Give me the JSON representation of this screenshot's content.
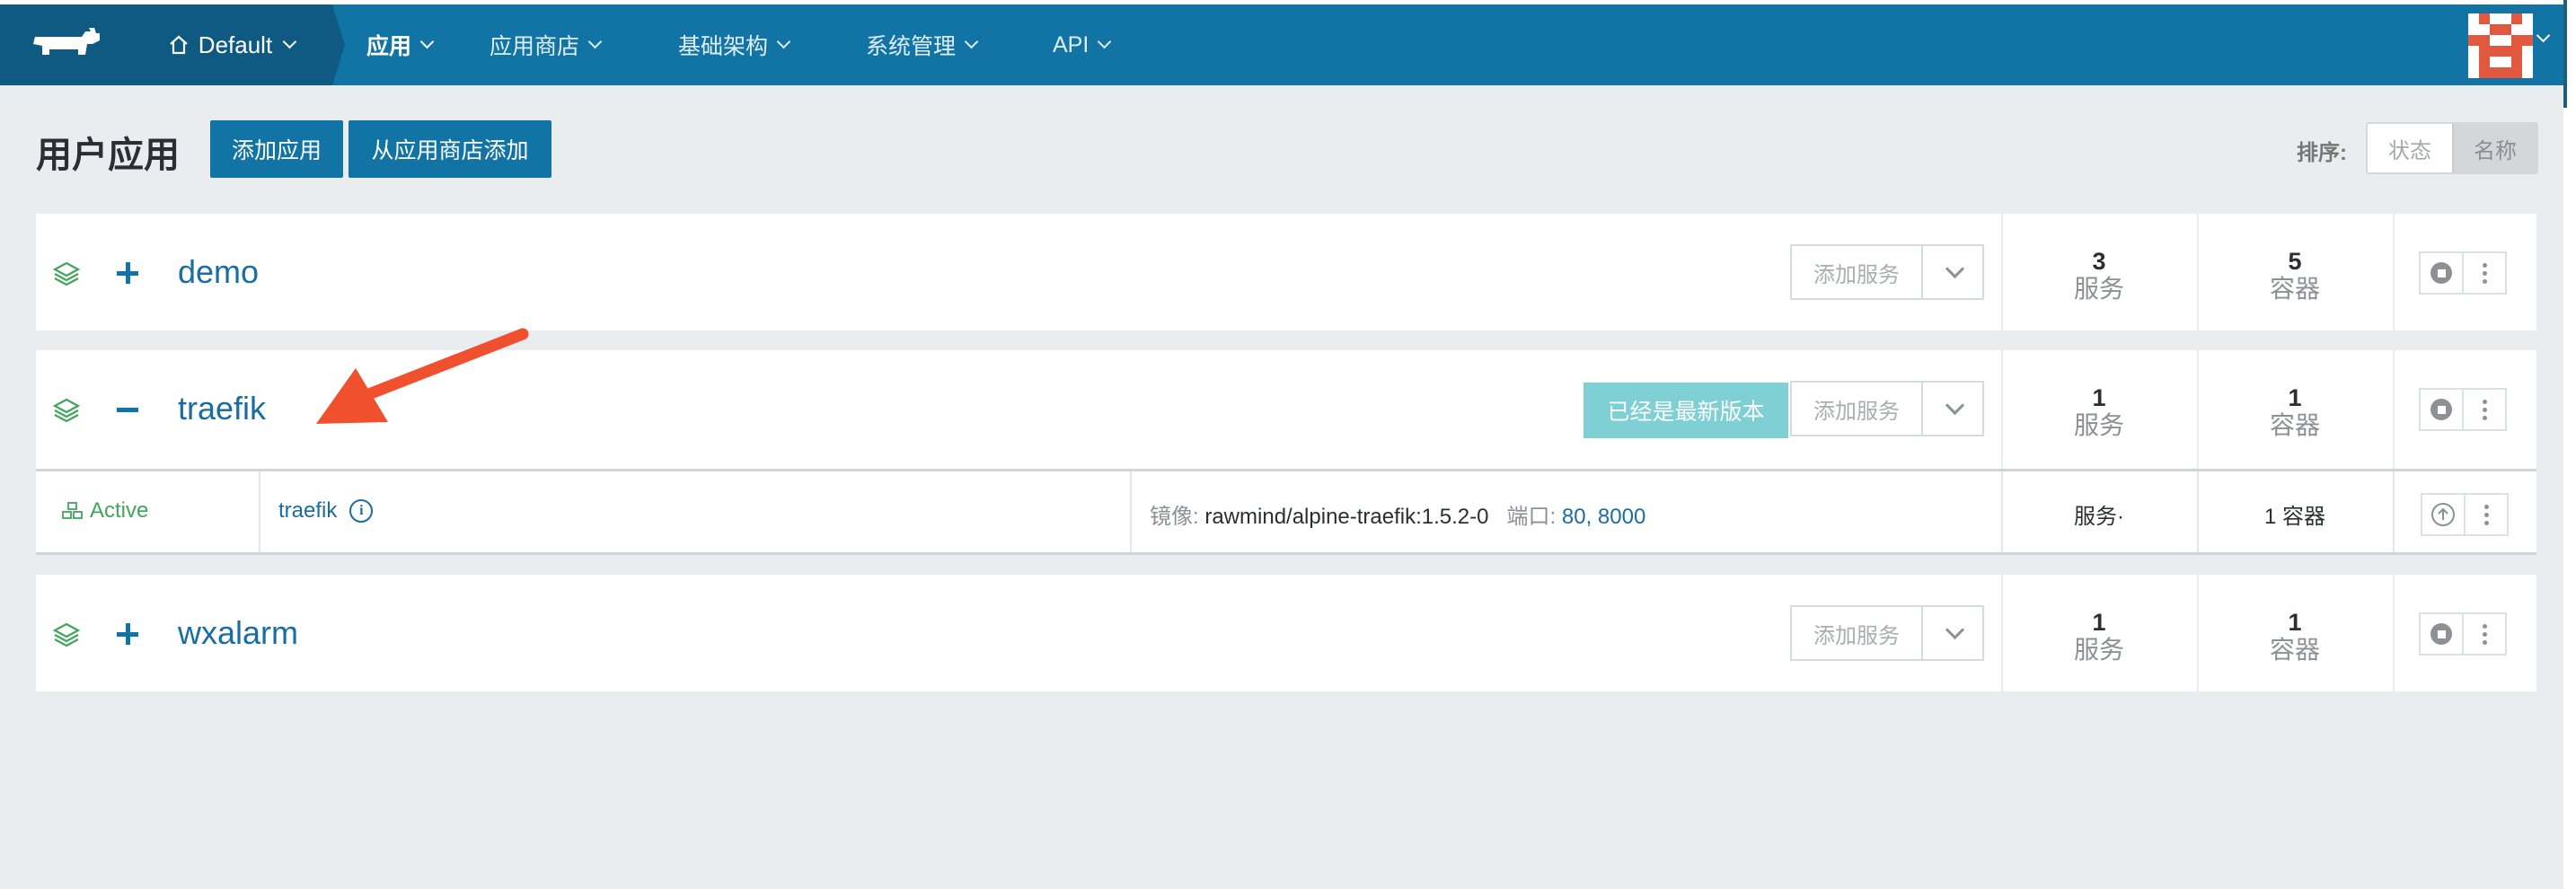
{
  "topbar": {
    "environment": "Default",
    "nav": [
      {
        "label": "应用",
        "active": true
      },
      {
        "label": "应用商店",
        "active": false
      },
      {
        "label": "基础架构",
        "active": false
      },
      {
        "label": "系统管理",
        "active": false
      },
      {
        "label": "API",
        "active": false
      }
    ]
  },
  "header": {
    "title": "用户应用",
    "add_stack_button": "添加应用",
    "add_from_catalog_button": "从应用商店添加",
    "sort_label": "排序:",
    "sort_options": [
      "状态",
      "名称"
    ],
    "sort_selected": "名称"
  },
  "stacks": [
    {
      "name": "demo",
      "expanded": false,
      "add_service_label": "添加服务",
      "services_count": "3",
      "services_unit": "服务",
      "containers_count": "5",
      "containers_unit": "容器"
    },
    {
      "name": "traefik",
      "expanded": true,
      "upgrade_label": "已经是最新版本",
      "add_service_label": "添加服务",
      "services_count": "1",
      "services_unit": "服务",
      "containers_count": "1",
      "containers_unit": "容器",
      "services": [
        {
          "state": "Active",
          "name": "traefik",
          "image_label": "镜像:",
          "image": "rawmind/alpine-traefik:1.5.2-0",
          "ports_label": "端口:",
          "ports": [
            "80",
            "8000"
          ],
          "scale_label": "服务·",
          "containers_label": "1 容器"
        }
      ]
    },
    {
      "name": "wxalarm",
      "expanded": false,
      "add_service_label": "添加服务",
      "services_count": "1",
      "services_unit": "服务",
      "containers_count": "1",
      "containers_unit": "容器"
    }
  ],
  "colors": {
    "topbar": "#1274a5",
    "topbar_dark": "#0f5a83",
    "link": "#1a6da0",
    "active_green": "#3fa65a",
    "upgrade_button": "#7fd0d4",
    "annotation_arrow": "#f0502e"
  }
}
